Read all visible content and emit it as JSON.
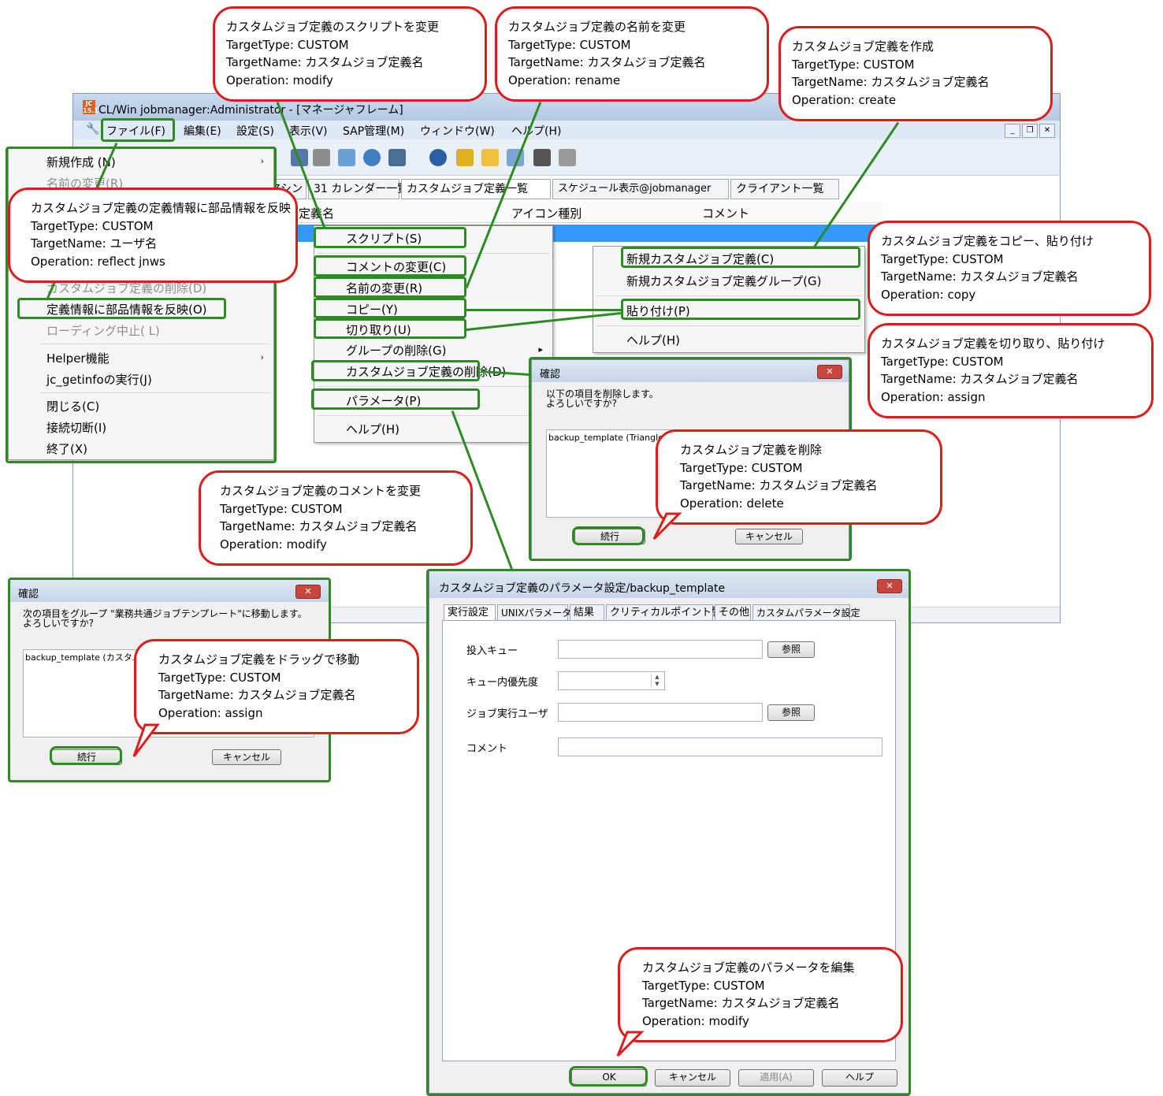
{
  "window": {
    "title": "CL/Win jobmanager:Administrator - [マネージャフレーム]",
    "menu": [
      "ファイル(F)",
      "編集(E)",
      "設定(S)",
      "表示(V)",
      "SAP管理(M)",
      "ウィンドウ(W)",
      "ヘルプ(H)"
    ],
    "tabs": [
      "マシン",
      "31 カレンダー一覧",
      "カスタムジョブ定義一覧",
      "スケジュール表示@jobmanager",
      "クライアント一覧"
    ],
    "columns": [
      "定義名",
      "アイコン種別",
      "コメント"
    ]
  },
  "file_menu": {
    "items": [
      "新規作成 (N)",
      "名前の変更(R)",
      "カスタムジョブ定義の削除(D)",
      "定義情報に部品情報を反映(O)",
      "ローディング中止( L)",
      "Helper機能",
      "jc_getinfoの実行(J)",
      "閉じる(C)",
      "接続切断(I)",
      "終了(X)"
    ]
  },
  "context_menu": {
    "items": [
      "スクリプト(S)",
      "コメントの変更(C)",
      "名前の変更(R)",
      "コピー(Y)",
      "切り取り(U)",
      "グループの削除(G)",
      "カスタムジョブ定義の削除(D)",
      "パラメータ(P)",
      "ヘルプ(H)"
    ]
  },
  "blank_menu": {
    "items": [
      "新規カスタムジョブ定義(C)",
      "新規カスタムジョブ定義グループ(G)",
      "貼り付け(P)",
      "ヘルプ(H)"
    ]
  },
  "delete_dialog": {
    "title": "確認",
    "message_1": "以下の項目を削除します。",
    "message_2": "よろしいですか?",
    "item": "backup_template (Triangle)",
    "ok": "続行",
    "cancel": "キャンセル"
  },
  "move_dialog": {
    "title": "確認",
    "message_1": "次の項目をグループ \"業務共通ジョブテンプレート\"に移動します。",
    "message_2": "よろしいですか?",
    "item": "backup_template (カスタム",
    "ok": "続行",
    "cancel": "キャンセル"
  },
  "param_dialog": {
    "title": "カスタムジョブ定義のパラメータ設定/backup_template",
    "tabs": [
      "実行設定",
      "UNIXパラメータ",
      "結果",
      "クリティカルポイント警告",
      "その他",
      "カスタムパラメータ設定"
    ],
    "labels": [
      "投入キュー",
      "キュー内優先度",
      "ジョブ実行ユーザ",
      "コメント"
    ],
    "browse": "参照",
    "buttons": [
      "OK",
      "キャンセル",
      "適用(A)",
      "ヘルプ"
    ]
  },
  "callouts": {
    "script": [
      "カスタムジョブ定義のスクリプトを変更",
      "TargetType: CUSTOM",
      "TargetName: カスタムジョブ定義名",
      "Operation: modify"
    ],
    "rename": [
      "カスタムジョブ定義の名前を変更",
      "TargetType: CUSTOM",
      "TargetName: カスタムジョブ定義名",
      "Operation: rename"
    ],
    "create": [
      "カスタムジョブ定義を作成",
      "TargetType: CUSTOM",
      "TargetName: カスタムジョブ定義名",
      "Operation: create"
    ],
    "reflect": [
      "カスタムジョブ定義の定義情報に部品情報を反映",
      "TargetType: CUSTOM",
      "TargetName: ユーザ名",
      "Operation: reflect jnws"
    ],
    "copy": [
      "カスタムジョブ定義をコピー、貼り付け",
      "TargetType: CUSTOM",
      "TargetName: カスタムジョブ定義名",
      "Operation: copy"
    ],
    "cut": [
      "カスタムジョブ定義を切り取り、貼り付け",
      "TargetType: CUSTOM",
      "TargetName: カスタムジョブ定義名",
      "Operation: assign"
    ],
    "delete": [
      "カスタムジョブ定義を削除",
      "TargetType: CUSTOM",
      "TargetName: カスタムジョブ定義名",
      "Operation: delete"
    ],
    "comment": [
      "カスタムジョブ定義のコメントを変更",
      "TargetType: CUSTOM",
      "TargetName: カスタムジョブ定義名",
      "Operation: modify"
    ],
    "drag": [
      "カスタムジョブ定義をドラッグで移動",
      "TargetType: CUSTOM",
      "TargetName: カスタムジョブ定義名",
      "Operation: assign"
    ],
    "param": [
      "カスタムジョブ定義のパラメータを編集",
      "TargetType: CUSTOM",
      "TargetName: カスタムジョブ定義名",
      "Operation: modify"
    ]
  },
  "colors": {
    "callout_border": "#e01b1b",
    "highlight": "#2e8b22",
    "selection": "#3399ff"
  }
}
